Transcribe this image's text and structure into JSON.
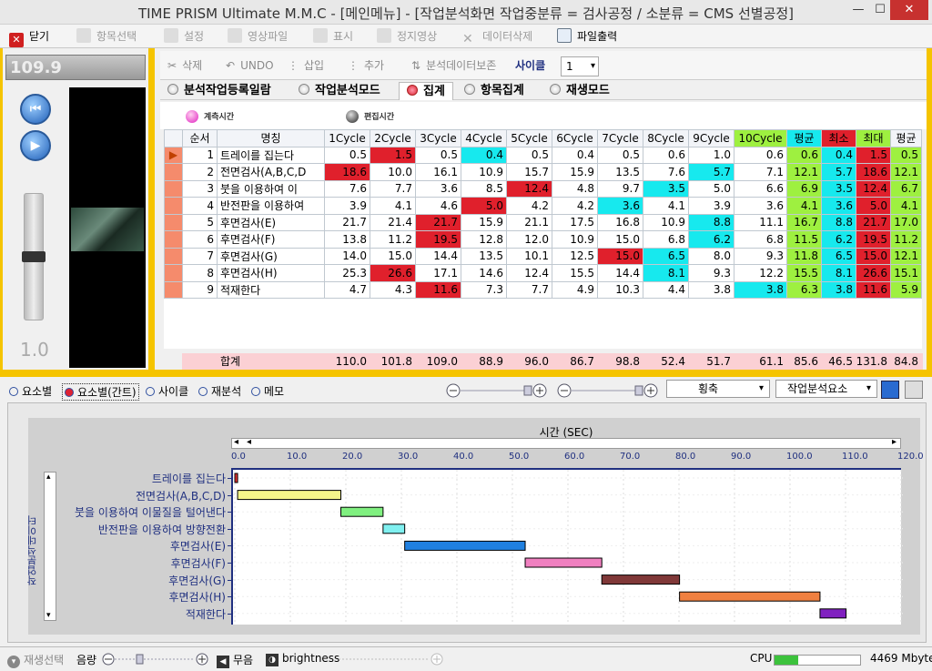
{
  "window": {
    "title": "TIME PRISM Ultimate M.M.C - [메인메뉴] - [작업분석화면 작업중분류 = 검사공정  /  소분류 = CMS 선별공정]",
    "minimize": "—",
    "maximize": "☐",
    "close": "✕"
  },
  "toolbar": {
    "close": "닫기",
    "items": "항목선택",
    "settings": "설정",
    "video": "영상파일",
    "display": "표시",
    "still": "정지영상",
    "delete_data": "데이터삭제",
    "export": "파일출력"
  },
  "player": {
    "time": "109.9",
    "speed": "1.0"
  },
  "actions": {
    "delete": "삭제",
    "undo": "UNDO",
    "insert": "삽입",
    "add": "추가",
    "save_data": "분석데이터보존",
    "cycle_label": "사이클",
    "cycle_value": "1"
  },
  "tabs": [
    "분석작업등록일람",
    "작업분석모드",
    "집계",
    "항목집계",
    "재생모드"
  ],
  "legend": {
    "measure": "계측시간",
    "edit": "편집시간"
  },
  "table": {
    "headers": [
      "순서",
      "명칭",
      "1Cycle",
      "2Cycle",
      "3Cycle",
      "4Cycle",
      "5Cycle",
      "6Cycle",
      "7Cycle",
      "8Cycle",
      "9Cycle",
      "10Cycle",
      "평균",
      "최소",
      "최대",
      "평균"
    ],
    "rows": [
      {
        "no": "1",
        "name": "트레이를 집는다",
        "v": [
          "0.5",
          "1.5",
          "0.5",
          "0.4",
          "0.5",
          "0.4",
          "0.5",
          "0.6",
          "1.0",
          "0.6",
          "0.6",
          "0.4",
          "1.5",
          "0.5"
        ]
      },
      {
        "no": "2",
        "name": "전면검사(A,B,C,D",
        "v": [
          "18.6",
          "10.0",
          "16.1",
          "10.9",
          "15.7",
          "15.9",
          "13.5",
          "7.6",
          "5.7",
          "7.1",
          "12.1",
          "5.7",
          "18.6",
          "12.1"
        ]
      },
      {
        "no": "3",
        "name": "붓을 이용하여 이",
        "v": [
          "7.6",
          "7.7",
          "3.6",
          "8.5",
          "12.4",
          "4.8",
          "9.7",
          "3.5",
          "5.0",
          "6.6",
          "6.9",
          "3.5",
          "12.4",
          "6.7"
        ]
      },
      {
        "no": "4",
        "name": "반전판을 이용하여",
        "v": [
          "3.9",
          "4.1",
          "4.6",
          "5.0",
          "4.2",
          "4.2",
          "3.6",
          "4.1",
          "3.9",
          "3.6",
          "4.1",
          "3.6",
          "5.0",
          "4.1"
        ]
      },
      {
        "no": "5",
        "name": "후면검사(E)",
        "v": [
          "21.7",
          "21.4",
          "21.7",
          "15.9",
          "21.1",
          "17.5",
          "16.8",
          "10.9",
          "8.8",
          "11.1",
          "16.7",
          "8.8",
          "21.7",
          "17.0"
        ]
      },
      {
        "no": "6",
        "name": "후면검사(F)",
        "v": [
          "13.8",
          "11.2",
          "19.5",
          "12.8",
          "12.0",
          "10.9",
          "15.0",
          "6.8",
          "6.2",
          "6.8",
          "11.5",
          "6.2",
          "19.5",
          "11.2"
        ]
      },
      {
        "no": "7",
        "name": "후면검사(G)",
        "v": [
          "14.0",
          "15.0",
          "14.4",
          "13.5",
          "10.1",
          "12.5",
          "15.0",
          "6.5",
          "8.0",
          "9.3",
          "11.8",
          "6.5",
          "15.0",
          "12.1"
        ]
      },
      {
        "no": "8",
        "name": "후면검사(H)",
        "v": [
          "25.3",
          "26.6",
          "17.1",
          "14.6",
          "12.4",
          "15.5",
          "14.4",
          "8.1",
          "9.3",
          "12.2",
          "15.5",
          "8.1",
          "26.6",
          "15.1"
        ]
      },
      {
        "no": "9",
        "name": "적재한다",
        "v": [
          "4.7",
          "4.3",
          "11.6",
          "7.3",
          "7.7",
          "4.9",
          "10.3",
          "4.4",
          "3.8",
          "3.8",
          "6.3",
          "3.8",
          "11.6",
          "5.9"
        ]
      }
    ],
    "sum_label": "합계",
    "sum": [
      "110.0",
      "101.8",
      "109.0",
      "88.9",
      "96.0",
      "86.7",
      "98.8",
      "52.4",
      "51.7",
      "61.1",
      "85.6",
      "46.5",
      "131.8",
      "84.8"
    ]
  },
  "bottom_tabs": [
    "요소별",
    "요소별(간트)",
    "사이클",
    "재분석",
    "메모"
  ],
  "dropdowns": {
    "axis": "횡축",
    "element": "작업분석요소"
  },
  "chart_data": {
    "type": "gantt",
    "title": "시간 (SEC)",
    "ylabel": "작업분석데이터",
    "xlim": [
      0,
      120
    ],
    "xticks": [
      "0.0",
      "10.0",
      "20.0",
      "30.0",
      "40.0",
      "50.0",
      "60.0",
      "70.0",
      "80.0",
      "90.0",
      "100.0",
      "110.0",
      "120.0"
    ],
    "tasks": [
      {
        "name": "트레이를 집는다",
        "start": 0.0,
        "end": 0.5,
        "color": "#e03030"
      },
      {
        "name": "전면검사(A,B,C,D)",
        "start": 0.5,
        "end": 19.1,
        "color": "#f5f58a"
      },
      {
        "name": "붓을 이용하여 이물질을 털어낸다",
        "start": 19.1,
        "end": 26.7,
        "color": "#80f080"
      },
      {
        "name": "반전판을 이용하여 방향전환",
        "start": 26.7,
        "end": 30.6,
        "color": "#80f0f0"
      },
      {
        "name": "후면검사(E)",
        "start": 30.6,
        "end": 52.3,
        "color": "#2080e0"
      },
      {
        "name": "후면검사(F)",
        "start": 52.3,
        "end": 66.1,
        "color": "#f080c0"
      },
      {
        "name": "후면검사(G)",
        "start": 66.1,
        "end": 80.1,
        "color": "#803838"
      },
      {
        "name": "후면검사(H)",
        "start": 80.1,
        "end": 105.4,
        "color": "#f08040"
      },
      {
        "name": "적재한다",
        "start": 105.4,
        "end": 110.1,
        "color": "#8020c0"
      }
    ]
  },
  "status": {
    "playback": "재생선택",
    "volume": "음량",
    "mute": "무음",
    "brightness": "brightness",
    "cpu": "CPU",
    "memory": "4469 Mbyte"
  }
}
